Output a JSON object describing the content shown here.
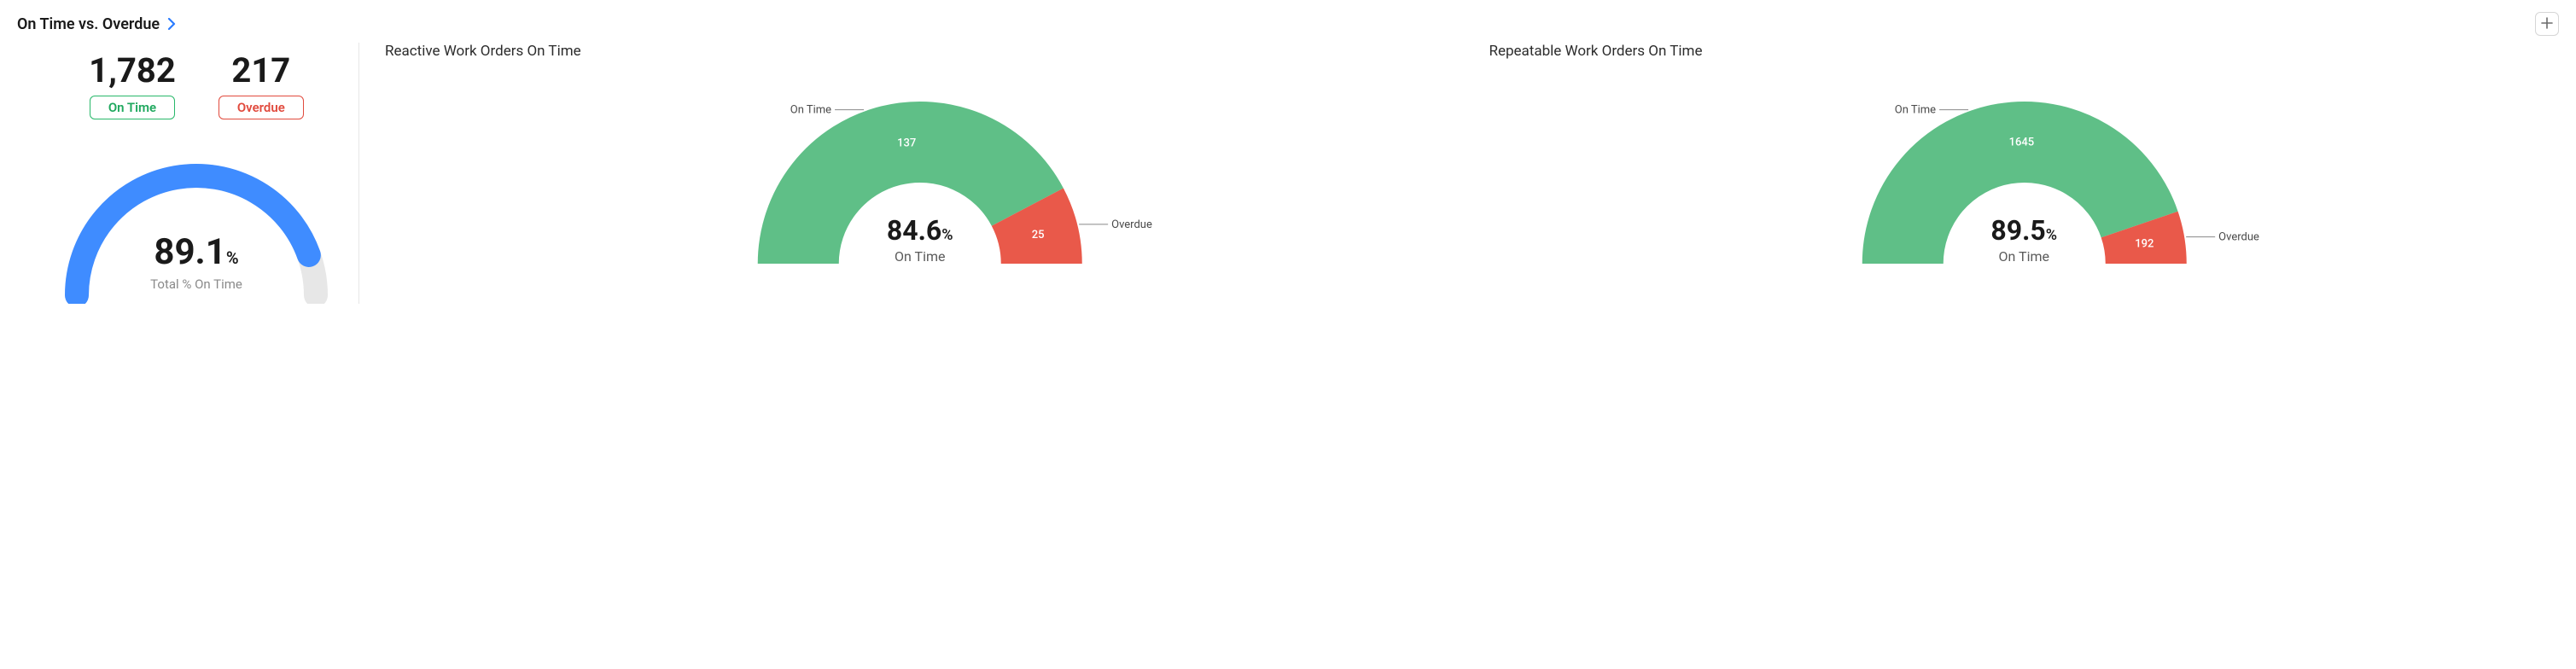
{
  "header": {
    "title": "On Time vs. Overdue",
    "add_button_aria": "Add"
  },
  "summary": {
    "on_time_count": "1,782",
    "overdue_count": "217",
    "on_time_label": "On Time",
    "overdue_label": "Overdue",
    "gauge_percent": "89.1",
    "gauge_percent_symbol": "%",
    "gauge_sub": "Total % On Time"
  },
  "charts": {
    "reactive": {
      "title": "Reactive Work Orders On Time",
      "on_time_value": "137",
      "overdue_value": "25",
      "percent": "84.6",
      "percent_symbol": "%",
      "sub_label": "On Time",
      "on_time_callout": "On Time",
      "overdue_callout": "Overdue"
    },
    "repeatable": {
      "title": "Repeatable Work Orders On Time",
      "on_time_value": "1645",
      "overdue_value": "192",
      "percent": "89.5",
      "percent_symbol": "%",
      "sub_label": "On Time",
      "on_time_callout": "On Time",
      "overdue_callout": "Overdue"
    }
  },
  "colors": {
    "green": "#5fbf87",
    "red": "#e9594a",
    "blue": "#3f8cff",
    "track": "#e7e7e7"
  },
  "chart_data": [
    {
      "type": "pie",
      "title": "Total % On Time (gauge)",
      "series": [
        {
          "name": "On Time %",
          "value": 89.1
        },
        {
          "name": "Overdue %",
          "value": 10.9
        }
      ],
      "counts": {
        "on_time": 1782,
        "overdue": 217
      },
      "ylim": [
        0,
        100
      ]
    },
    {
      "type": "pie",
      "title": "Reactive Work Orders On Time",
      "series": [
        {
          "name": "On Time",
          "value": 137
        },
        {
          "name": "Overdue",
          "value": 25
        }
      ],
      "percent_on_time": 84.6
    },
    {
      "type": "pie",
      "title": "Repeatable Work Orders On Time",
      "series": [
        {
          "name": "On Time",
          "value": 1645
        },
        {
          "name": "Overdue",
          "value": 192
        }
      ],
      "percent_on_time": 89.5
    }
  ]
}
